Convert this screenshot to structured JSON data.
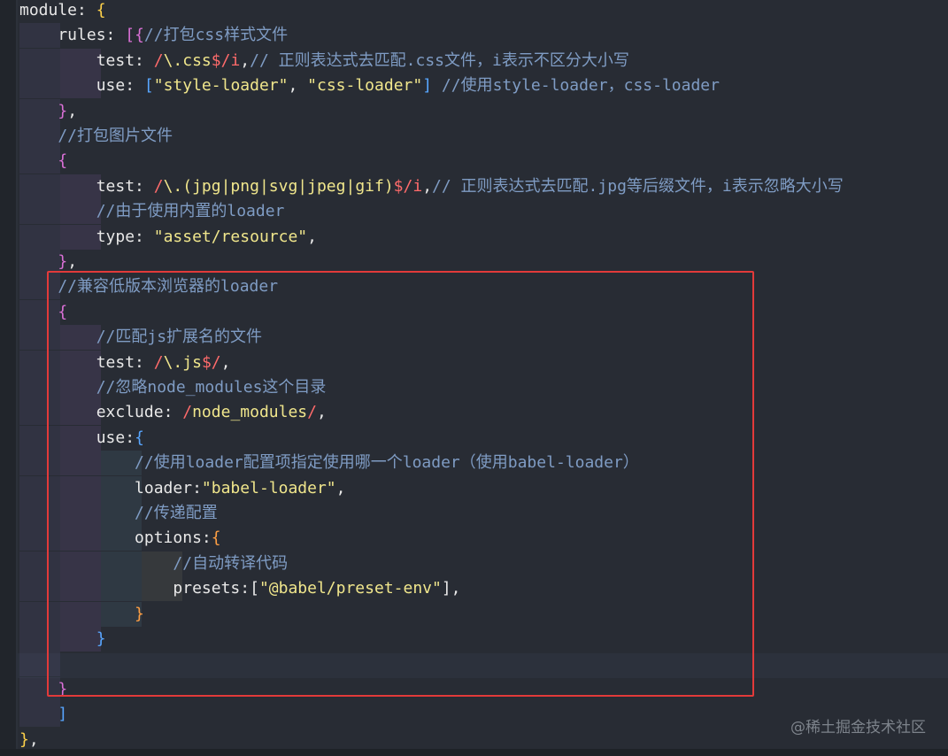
{
  "code": {
    "lines": [
      {
        "parts": [
          {
            "t": "module",
            "c": "t-key"
          },
          {
            "t": ": ",
            "c": "t-punc"
          },
          {
            "t": "{",
            "c": "t-brace"
          }
        ]
      },
      {
        "parts": [
          {
            "t": "    rules",
            "c": "t-key"
          },
          {
            "t": ": ",
            "c": "t-punc"
          },
          {
            "t": "[{",
            "c": "t-brace2"
          },
          {
            "t": "//打包css样式文件",
            "c": "t-cmt"
          }
        ]
      },
      {
        "parts": [
          {
            "t": "        test",
            "c": "t-key"
          },
          {
            "t": ": ",
            "c": "t-punc"
          },
          {
            "t": "/",
            "c": "t-re"
          },
          {
            "t": "\\.css",
            "c": "t-rew"
          },
          {
            "t": "$",
            "c": "t-re"
          },
          {
            "t": "/i",
            "c": "t-re"
          },
          {
            "t": ",",
            "c": "t-punc"
          },
          {
            "t": "// 正则表达式去匹配.css文件，i表示不区分大小写",
            "c": "t-cmt"
          }
        ]
      },
      {
        "parts": [
          {
            "t": "        use",
            "c": "t-key"
          },
          {
            "t": ": ",
            "c": "t-punc"
          },
          {
            "t": "[",
            "c": "t-brace3"
          },
          {
            "t": "\"style-loader\"",
            "c": "t-str"
          },
          {
            "t": ", ",
            "c": "t-punc"
          },
          {
            "t": "\"css-loader\"",
            "c": "t-str"
          },
          {
            "t": "] ",
            "c": "t-brace3"
          },
          {
            "t": "//使用style-loader，css-loader",
            "c": "t-cmt"
          }
        ]
      },
      {
        "parts": [
          {
            "t": "    ",
            "c": "t-punc"
          },
          {
            "t": "}",
            "c": "t-brace2"
          },
          {
            "t": ",",
            "c": "t-punc"
          }
        ]
      },
      {
        "parts": [
          {
            "t": "    //打包图片文件",
            "c": "t-cmt"
          }
        ]
      },
      {
        "parts": [
          {
            "t": "    ",
            "c": "t-punc"
          },
          {
            "t": "{",
            "c": "t-brace2"
          }
        ]
      },
      {
        "parts": [
          {
            "t": "        test",
            "c": "t-key"
          },
          {
            "t": ": ",
            "c": "t-punc"
          },
          {
            "t": "/",
            "c": "t-re"
          },
          {
            "t": "\\.(jpg|png|svg|jpeg|gif)",
            "c": "t-rew"
          },
          {
            "t": "$",
            "c": "t-re"
          },
          {
            "t": "/i",
            "c": "t-re"
          },
          {
            "t": ",",
            "c": "t-punc"
          },
          {
            "t": "// 正则表达式去匹配.jpg等后缀文件，i表示忽略大小写",
            "c": "t-cmt"
          }
        ]
      },
      {
        "parts": [
          {
            "t": "        //由于使用内置的loader",
            "c": "t-cmt"
          }
        ]
      },
      {
        "parts": [
          {
            "t": "        type",
            "c": "t-key"
          },
          {
            "t": ": ",
            "c": "t-punc"
          },
          {
            "t": "\"asset/resource\"",
            "c": "t-str"
          },
          {
            "t": ",",
            "c": "t-punc"
          }
        ]
      },
      {
        "parts": [
          {
            "t": "    ",
            "c": "t-punc"
          },
          {
            "t": "}",
            "c": "t-brace2"
          },
          {
            "t": ",",
            "c": "t-punc"
          }
        ]
      },
      {
        "parts": [
          {
            "t": "    //兼容低版本浏览器的loader",
            "c": "t-cmt"
          }
        ]
      },
      {
        "parts": [
          {
            "t": "    ",
            "c": "t-punc"
          },
          {
            "t": "{",
            "c": "t-brace2"
          }
        ]
      },
      {
        "parts": [
          {
            "t": "        //匹配js扩展名的文件",
            "c": "t-cmt"
          }
        ]
      },
      {
        "parts": [
          {
            "t": "        test",
            "c": "t-key"
          },
          {
            "t": ": ",
            "c": "t-punc"
          },
          {
            "t": "/",
            "c": "t-re"
          },
          {
            "t": "\\.js",
            "c": "t-rew"
          },
          {
            "t": "$",
            "c": "t-re"
          },
          {
            "t": "/",
            "c": "t-re"
          },
          {
            "t": ",",
            "c": "t-punc"
          }
        ]
      },
      {
        "parts": [
          {
            "t": "        //忽略node_modules这个目录",
            "c": "t-cmt"
          }
        ]
      },
      {
        "parts": [
          {
            "t": "        exclude",
            "c": "t-key"
          },
          {
            "t": ": ",
            "c": "t-punc"
          },
          {
            "t": "/",
            "c": "t-re"
          },
          {
            "t": "node_modules",
            "c": "t-rew"
          },
          {
            "t": "/",
            "c": "t-re"
          },
          {
            "t": ",",
            "c": "t-punc"
          }
        ]
      },
      {
        "parts": [
          {
            "t": "        use",
            "c": "t-key"
          },
          {
            "t": ":",
            "c": "t-punc"
          },
          {
            "t": "{",
            "c": "t-brace3"
          }
        ]
      },
      {
        "parts": [
          {
            "t": "            //使用loader配置项指定使用哪一个loader（使用babel-loader）",
            "c": "t-cmt"
          }
        ]
      },
      {
        "parts": [
          {
            "t": "            loader",
            "c": "t-key"
          },
          {
            "t": ":",
            "c": "t-punc"
          },
          {
            "t": "\"babel-loader\"",
            "c": "t-str"
          },
          {
            "t": ",",
            "c": "t-punc"
          }
        ]
      },
      {
        "parts": [
          {
            "t": "            //传递配置",
            "c": "t-cmt"
          }
        ]
      },
      {
        "parts": [
          {
            "t": "            options",
            "c": "t-key"
          },
          {
            "t": ":",
            "c": "t-punc"
          },
          {
            "t": "{",
            "c": "t-brace4"
          }
        ]
      },
      {
        "parts": [
          {
            "t": "                //自动转译代码",
            "c": "t-cmt"
          }
        ]
      },
      {
        "parts": [
          {
            "t": "                presets",
            "c": "t-key"
          },
          {
            "t": ":",
            "c": "t-punc"
          },
          {
            "t": "[",
            "c": "t-punc"
          },
          {
            "t": "\"@babel/preset-env\"",
            "c": "t-str"
          },
          {
            "t": "],",
            "c": "t-punc"
          }
        ]
      },
      {
        "parts": [
          {
            "t": "            ",
            "c": "t-punc"
          },
          {
            "t": "}",
            "c": "t-brace4"
          }
        ]
      },
      {
        "parts": [
          {
            "t": "        ",
            "c": "t-punc"
          },
          {
            "t": "}",
            "c": "t-brace3"
          }
        ]
      },
      {
        "parts": [
          {
            "t": "",
            "c": "t-punc"
          }
        ]
      },
      {
        "parts": [
          {
            "t": "    ",
            "c": "t-punc"
          },
          {
            "t": "}",
            "c": "t-brace2"
          }
        ]
      },
      {
        "parts": [
          {
            "t": "    ",
            "c": "t-punc"
          },
          {
            "t": "]",
            "c": "t-brace3"
          }
        ]
      },
      {
        "parts": [
          {
            "t": "}",
            "c": "t-brace"
          },
          {
            "t": ",",
            "c": "t-punc"
          }
        ]
      }
    ]
  },
  "watermark": "@稀土掘金技术社区",
  "highlight_color": "#e23a3a"
}
